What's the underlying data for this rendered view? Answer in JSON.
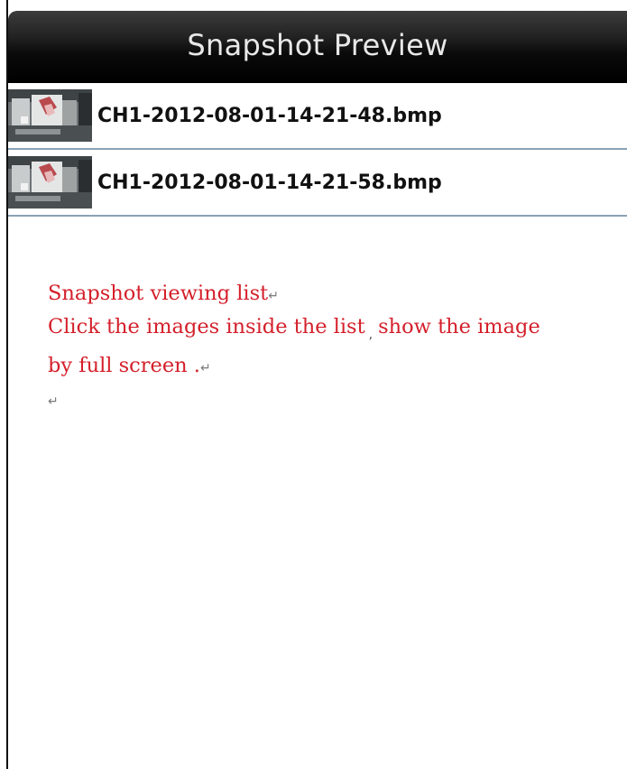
{
  "app": {
    "title": "Snapshot Preview"
  },
  "list": {
    "items": [
      {
        "filename": "CH1-2012-08-01-14-21-48.bmp",
        "thumbnail_icon": "camera-snapshot-thumbnail"
      },
      {
        "filename": "CH1-2012-08-01-14-21-58.bmp",
        "thumbnail_icon": "camera-snapshot-thumbnail"
      }
    ]
  },
  "annotation": {
    "line1": "Snapshot viewing list",
    "line2a": "Click the images inside the list",
    "line2_mark": ",",
    "line2b": "show the image",
    "line3": "by full screen .",
    "return_mark": "↵"
  },
  "colors": {
    "titlebar": "#000000",
    "title_text": "#e8e8e8",
    "divider": "#8aa2b6",
    "annotation_text": "#d41f2a"
  }
}
